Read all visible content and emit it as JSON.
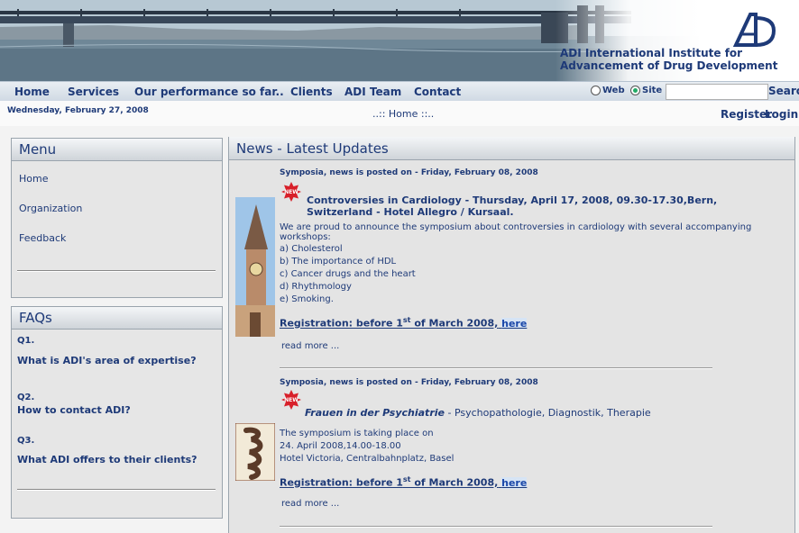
{
  "brand": {
    "line1": "ADI International Institute for",
    "line2": "Advancement of Drug Development"
  },
  "nav": {
    "items": [
      "Home",
      "Services",
      "Our performance so far..",
      "Clients",
      "ADI Team",
      "Contact"
    ],
    "search_scope": [
      "Web",
      "Site"
    ],
    "search_selected": "Site",
    "search_placeholder": "",
    "search_button": "Search"
  },
  "subbar": {
    "date": "Wednesday, February 27, 2008",
    "breadcrumb": "..:: Home ::..",
    "register": "Register",
    "login": "Login"
  },
  "menu": {
    "title": "Menu",
    "items": [
      "Home",
      "Organization",
      "Feedback"
    ]
  },
  "faqs": {
    "title": "FAQs",
    "items": [
      {
        "num": "Q1.",
        "q": "What is ADI's area of expertise?"
      },
      {
        "num": "Q2.",
        "q": "How to contact ADI?"
      },
      {
        "num": "Q3.",
        "q": "What ADI offers to their clients?"
      }
    ]
  },
  "news": {
    "title": "News - Latest Updates",
    "items": [
      {
        "meta": "Symposia, news is posted on - Friday, February 08, 2008",
        "headline": "Controversies in Cardiology - Thursday, April 17, 2008, 09.30-17.30,Bern, Switzerland - Hotel Allegro / Kursaal.",
        "intro": "We are proud to announce the symposium about controversies in cardiology with several accompanying workshops:",
        "list": [
          "a) Cholesterol",
          "b) The importance of HDL",
          "c) Cancer drugs and the heart",
          "d) Rhythmology",
          "e) Smoking."
        ],
        "reg_prefix": "Registration:  before 1",
        "reg_sup": "st",
        "reg_suffix": " of March 2008,",
        "reg_link": "here",
        "read_more": "read more ..."
      },
      {
        "meta": "Symposia, news is posted on - Friday, February 08, 2008",
        "headline_em": "Frauen in der Psychiatrie",
        "headline_rest": " - Psychopathologie, Diagnostik, Therapie",
        "lines": [
          "The symposium is taking place on",
          "24. April 2008,14.00-18.00",
          "Hotel Victoria, Centralbahnplatz, Basel"
        ],
        "reg_prefix": "Registration:  before 1",
        "reg_sup": "st",
        "reg_suffix": " of March 2008,",
        "reg_link": "here",
        "read_more": "read more ..."
      }
    ]
  },
  "colors": {
    "primary": "#1e3a78",
    "panel_bg": "#e6e6e6",
    "new_badge": "#d8202a"
  }
}
